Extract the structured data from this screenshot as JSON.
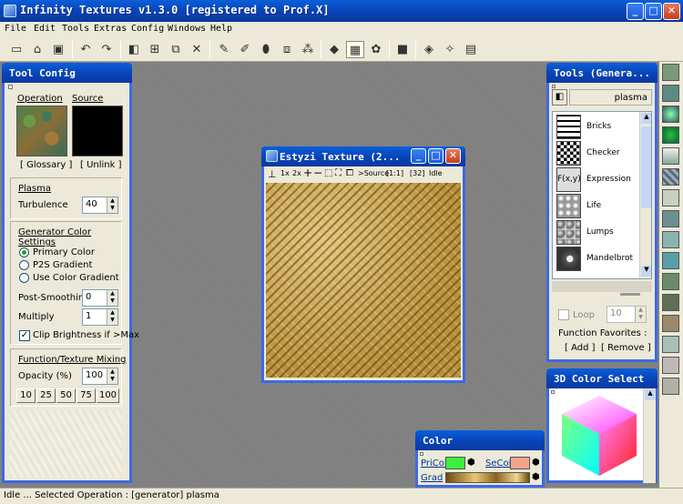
{
  "app": {
    "title": "Infinity Textures v1.3.0 [registered to Prof.X]"
  },
  "menu": [
    "File",
    "Edit",
    "Tools",
    "Extras",
    "Config",
    "Windows",
    "Help"
  ],
  "tool_config": {
    "title": "Tool Config",
    "operation_label": "Operation",
    "source_label": "Source",
    "operation_value": "[ Glossary ]",
    "source_value": "[ Unlink ]",
    "plasma_heading": "Plasma",
    "turbulence_label": "Turbulence",
    "turbulence_value": "40",
    "gen_color_heading": "Generator Color Settings",
    "radio_primary": "Primary Color",
    "radio_p2s": "P2S Gradient",
    "radio_gradient": "Use Color Gradient",
    "post_smoothing_label": "Post-Smoothing",
    "post_smoothing_value": "0",
    "multiply_label": "Multiply",
    "multiply_value": "1",
    "clip_label": "Clip Brightness if >Max",
    "mixing_heading": "Function/Texture Mixing",
    "opacity_label": "Opacity (%)",
    "opacity_value": "100",
    "opacity_presets": [
      "10",
      "25",
      "50",
      "75",
      "100"
    ]
  },
  "texture_window": {
    "title": "Estyzi Texture (2...",
    "toolbar": {
      "zoom1": "1x",
      "zoom2": "2x",
      "plus": "+",
      "minus": "−",
      "source": ">Source",
      "ratio": "[1:1]",
      "size": "[32]",
      "state": "Idle"
    }
  },
  "tools_window": {
    "title": "Tools (Genera...",
    "current": "plasma",
    "items": [
      "Bricks",
      "Checker",
      "Expression",
      "Life",
      "Lumps",
      "Mandelbrot"
    ],
    "expression_glyph": "F(x,y)",
    "loop_label": "Loop",
    "loop_value": "10",
    "favorites_label": "Function Favorites :",
    "add_label": "[ Add ]",
    "remove_label": "[ Remove ]"
  },
  "color_window": {
    "title": "Color",
    "pricol_label": "PriCol",
    "secol_label": "SeCol",
    "grad_label": "Grad",
    "pricol_color": "#3cf03c",
    "secol_color": "#f0a48c"
  },
  "color_select_window": {
    "title": "3D Color Select"
  },
  "status": {
    "text": "Idle ... Selected Operation : [generator] plasma"
  }
}
